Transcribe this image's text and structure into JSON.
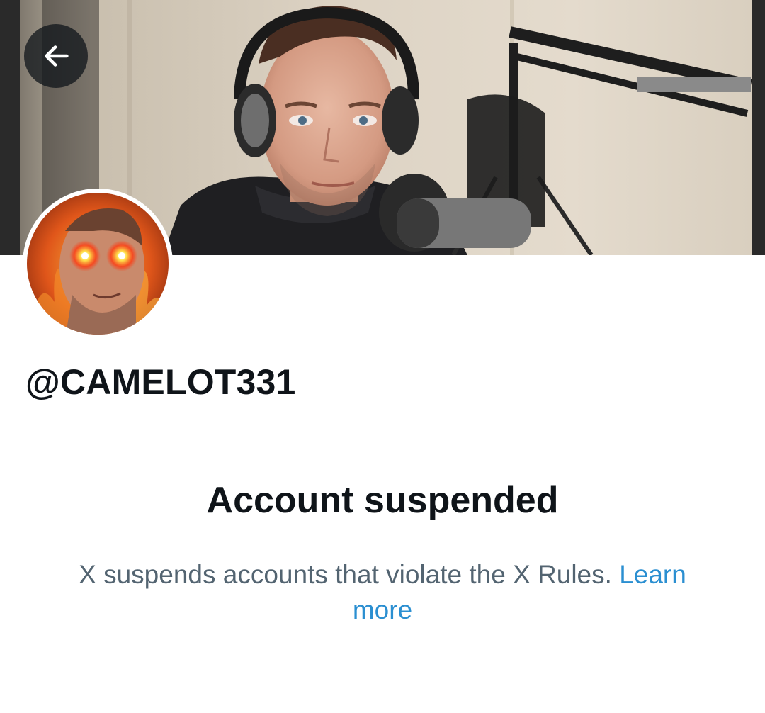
{
  "profile": {
    "handle": "@CAMELOT331",
    "banner_image": "podcast-studio-photo",
    "avatar_image": "profile-photo-glowing-eyes"
  },
  "navigation": {
    "back_icon": "arrow-left-icon"
  },
  "suspension": {
    "title": "Account suspended",
    "message": "X suspends accounts that violate the X Rules.",
    "link_label": "Learn more"
  },
  "colors": {
    "text_primary": "#0f1419",
    "text_secondary": "#536471",
    "link": "#2b8fd1"
  }
}
